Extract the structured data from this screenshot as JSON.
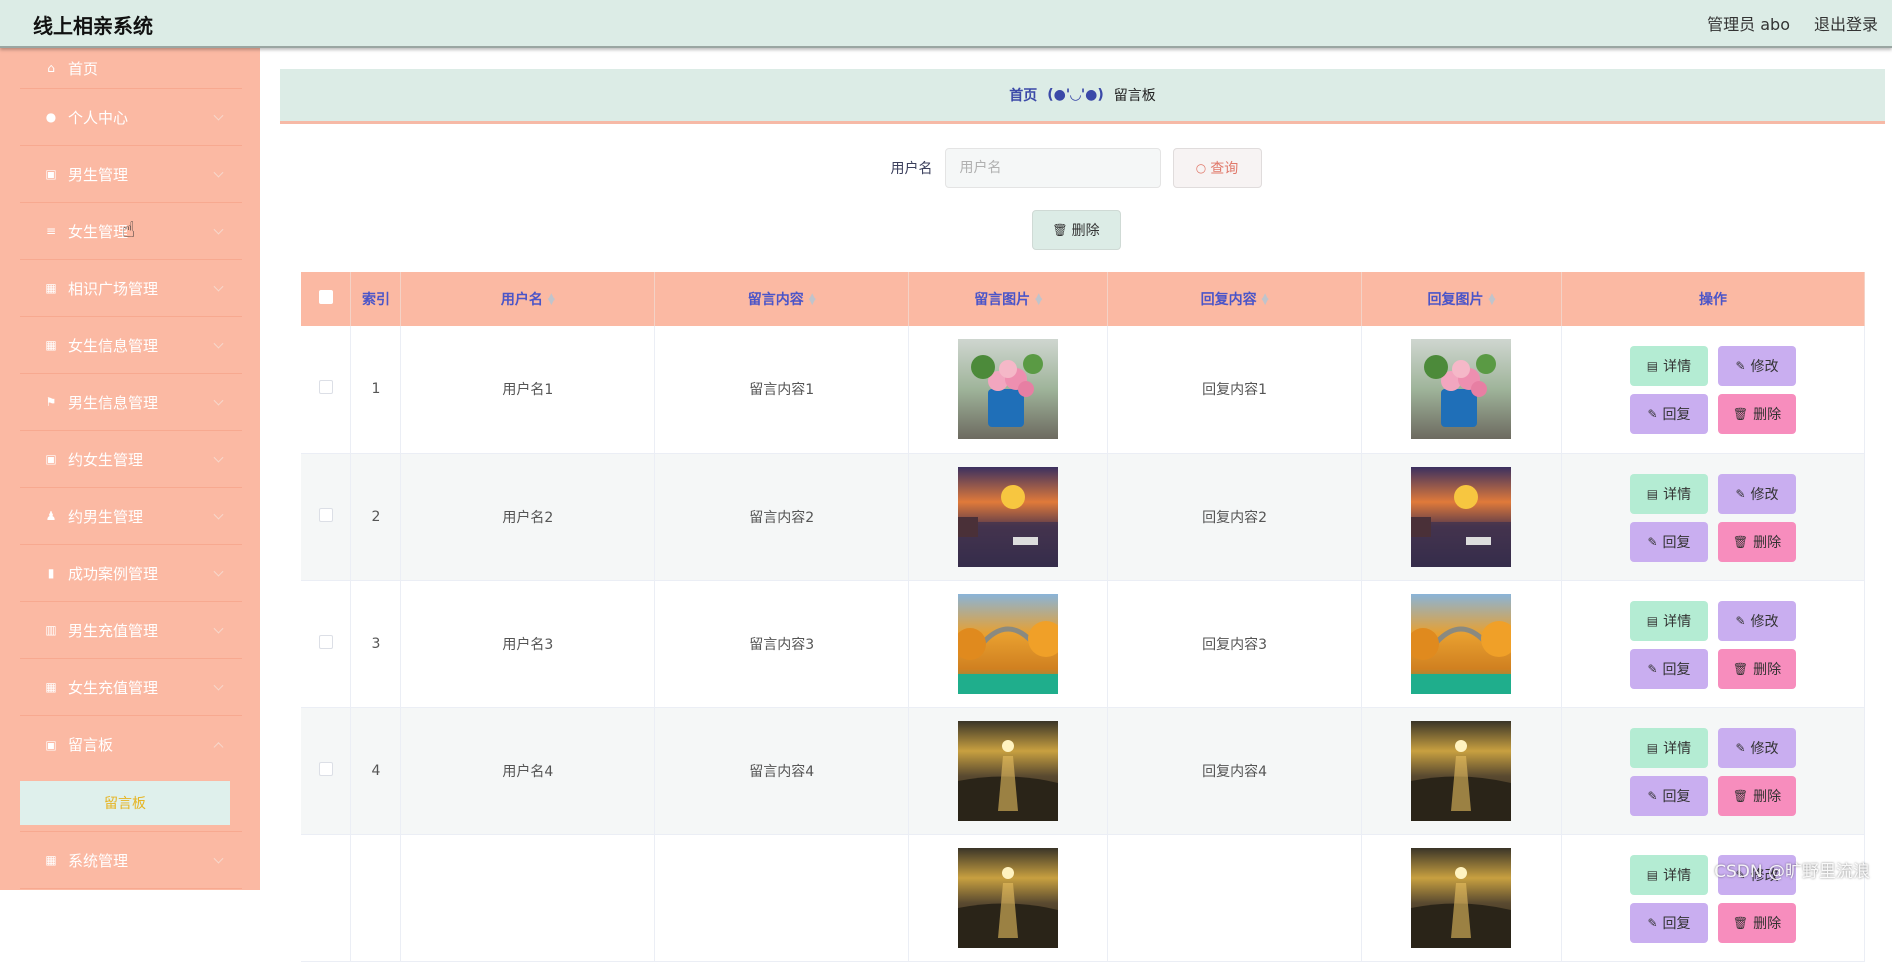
{
  "app": {
    "title": "线上相亲系统"
  },
  "header": {
    "admin_label": "管理员 abo",
    "logout_label": "退出登录"
  },
  "sidebar": {
    "items": [
      {
        "label": "首页",
        "icon": "home-icon"
      },
      {
        "label": "个人中心",
        "icon": "user-icon"
      },
      {
        "label": "男生管理",
        "icon": "clipboard-icon"
      },
      {
        "label": "女生管理",
        "icon": "list-icon"
      },
      {
        "label": "相识广场管理",
        "icon": "grid-icon"
      },
      {
        "label": "女生信息管理",
        "icon": "apps-icon"
      },
      {
        "label": "男生信息管理",
        "icon": "flag-icon"
      },
      {
        "label": "约女生管理",
        "icon": "clipboard-icon"
      },
      {
        "label": "约男生管理",
        "icon": "person-icon"
      },
      {
        "label": "成功案例管理",
        "icon": "chart-icon"
      },
      {
        "label": "男生充值管理",
        "icon": "building-icon"
      },
      {
        "label": "女生充值管理",
        "icon": "apps-icon"
      },
      {
        "label": "留言板",
        "icon": "clipboard-icon"
      }
    ],
    "sub_item": "留言板",
    "last_item": {
      "label": "系统管理",
      "icon": "apps-icon"
    }
  },
  "breadcrumb": {
    "home": "首页",
    "separator": "(●'◡'●)",
    "current": "留言板"
  },
  "search": {
    "label": "用户名",
    "placeholder": "用户名",
    "query_button": "查询"
  },
  "toolbar": {
    "delete_button": "删除"
  },
  "table": {
    "headers": [
      "索引",
      "用户名",
      "留言内容",
      "留言图片",
      "回复内容",
      "回复图片",
      "操作"
    ],
    "rows": [
      {
        "index": "1",
        "username": "用户名1",
        "content": "留言内容1",
        "image": "flowers-in-watering-can",
        "reply": "回复内容1",
        "reply_image": "flowers-in-watering-can"
      },
      {
        "index": "2",
        "username": "用户名2",
        "content": "留言内容2",
        "image": "sunset-river-boat",
        "reply": "回复内容2",
        "reply_image": "sunset-river-boat"
      },
      {
        "index": "3",
        "username": "用户名3",
        "content": "留言内容3",
        "image": "autumn-bridge-river",
        "reply": "回复内容3",
        "reply_image": "autumn-bridge-river"
      },
      {
        "index": "4",
        "username": "用户名4",
        "content": "留言内容4",
        "image": "sunset-beach",
        "reply": "回复内容4",
        "reply_image": "sunset-beach"
      },
      {
        "index": "",
        "username": "",
        "content": "",
        "image": "sunset-beach",
        "reply": "",
        "reply_image": "sunset-beach"
      }
    ],
    "actions": {
      "detail": "详情",
      "edit": "修改",
      "reply": "回复",
      "delete": "删除"
    }
  },
  "watermark": "CSDN @旷野里流浪",
  "colors": {
    "sidebar_bg": "#fbb9a3",
    "header_bg": "#dcece6",
    "header_text": "#4b55c8",
    "detail_btn": "#b4ecd3",
    "edit_btn": "#c9aef0",
    "delete_btn": "#f78dbd",
    "active_sub_text": "#e6b422"
  }
}
